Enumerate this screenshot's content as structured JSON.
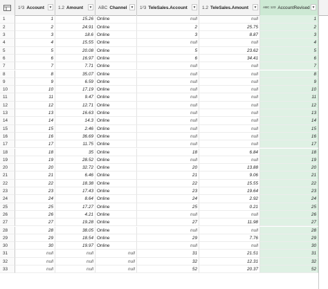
{
  "columns": [
    {
      "type_label": "1²3",
      "title": "Account"
    },
    {
      "type_label": "1.2",
      "title": "Amount"
    },
    {
      "type_label": "ABC",
      "title": "Channel"
    },
    {
      "type_label": "1²3",
      "title": "TeleSales.Account"
    },
    {
      "type_label": "1.2",
      "title": "TeleSales.Amount"
    },
    {
      "type_label": "ABC 123",
      "title": "AccountRevised"
    }
  ],
  "rows": [
    {
      "n": "1",
      "account": "1",
      "amount": "15.26",
      "channel": "Online",
      "ts_account": "null",
      "ts_amount": "null",
      "revised": "1"
    },
    {
      "n": "2",
      "account": "2",
      "amount": "24.91",
      "channel": "Online",
      "ts_account": "2",
      "ts_amount": "25.75",
      "revised": "2"
    },
    {
      "n": "3",
      "account": "3",
      "amount": "18.6",
      "channel": "Online",
      "ts_account": "3",
      "ts_amount": "8.87",
      "revised": "3"
    },
    {
      "n": "4",
      "account": "4",
      "amount": "15.55",
      "channel": "Online",
      "ts_account": "null",
      "ts_amount": "null",
      "revised": "4"
    },
    {
      "n": "5",
      "account": "5",
      "amount": "20.08",
      "channel": "Online",
      "ts_account": "5",
      "ts_amount": "23.62",
      "revised": "5"
    },
    {
      "n": "6",
      "account": "6",
      "amount": "16.97",
      "channel": "Online",
      "ts_account": "6",
      "ts_amount": "34.41",
      "revised": "6"
    },
    {
      "n": "7",
      "account": "7",
      "amount": "7.71",
      "channel": "Online",
      "ts_account": "null",
      "ts_amount": "null",
      "revised": "7"
    },
    {
      "n": "8",
      "account": "8",
      "amount": "35.07",
      "channel": "Online",
      "ts_account": "null",
      "ts_amount": "null",
      "revised": "8"
    },
    {
      "n": "9",
      "account": "9",
      "amount": "6.59",
      "channel": "Online",
      "ts_account": "null",
      "ts_amount": "null",
      "revised": "9"
    },
    {
      "n": "10",
      "account": "10",
      "amount": "17.19",
      "channel": "Online",
      "ts_account": "null",
      "ts_amount": "null",
      "revised": "10"
    },
    {
      "n": "11",
      "account": "11",
      "amount": "9.47",
      "channel": "Online",
      "ts_account": "null",
      "ts_amount": "null",
      "revised": "11"
    },
    {
      "n": "12",
      "account": "12",
      "amount": "12.71",
      "channel": "Online",
      "ts_account": "null",
      "ts_amount": "null",
      "revised": "12"
    },
    {
      "n": "13",
      "account": "13",
      "amount": "16.63",
      "channel": "Online",
      "ts_account": "null",
      "ts_amount": "null",
      "revised": "13"
    },
    {
      "n": "14",
      "account": "14",
      "amount": "14.3",
      "channel": "Online",
      "ts_account": "null",
      "ts_amount": "null",
      "revised": "14"
    },
    {
      "n": "15",
      "account": "15",
      "amount": "2.46",
      "channel": "Online",
      "ts_account": "null",
      "ts_amount": "null",
      "revised": "15"
    },
    {
      "n": "16",
      "account": "16",
      "amount": "36.69",
      "channel": "Online",
      "ts_account": "null",
      "ts_amount": "null",
      "revised": "16"
    },
    {
      "n": "17",
      "account": "17",
      "amount": "11.75",
      "channel": "Online",
      "ts_account": "null",
      "ts_amount": "null",
      "revised": "17"
    },
    {
      "n": "18",
      "account": "18",
      "amount": "35",
      "channel": "Online",
      "ts_account": "18",
      "ts_amount": "6.84",
      "revised": "18"
    },
    {
      "n": "19",
      "account": "19",
      "amount": "28.52",
      "channel": "Online",
      "ts_account": "null",
      "ts_amount": "null",
      "revised": "19"
    },
    {
      "n": "20",
      "account": "20",
      "amount": "32.72",
      "channel": "Online",
      "ts_account": "20",
      "ts_amount": "13.88",
      "revised": "20"
    },
    {
      "n": "21",
      "account": "21",
      "amount": "6.46",
      "channel": "Online",
      "ts_account": "21",
      "ts_amount": "9.06",
      "revised": "21"
    },
    {
      "n": "22",
      "account": "22",
      "amount": "18.38",
      "channel": "Online",
      "ts_account": "22",
      "ts_amount": "15.55",
      "revised": "22"
    },
    {
      "n": "23",
      "account": "23",
      "amount": "17.43",
      "channel": "Online",
      "ts_account": "23",
      "ts_amount": "19.64",
      "revised": "23"
    },
    {
      "n": "24",
      "account": "24",
      "amount": "8.64",
      "channel": "Online",
      "ts_account": "24",
      "ts_amount": "2.92",
      "revised": "24"
    },
    {
      "n": "25",
      "account": "25",
      "amount": "17.27",
      "channel": "Online",
      "ts_account": "25",
      "ts_amount": "0.21",
      "revised": "25"
    },
    {
      "n": "26",
      "account": "26",
      "amount": "4.21",
      "channel": "Online",
      "ts_account": "null",
      "ts_amount": "null",
      "revised": "26"
    },
    {
      "n": "27",
      "account": "27",
      "amount": "19.28",
      "channel": "Online",
      "ts_account": "27",
      "ts_amount": "11.98",
      "revised": "27"
    },
    {
      "n": "28",
      "account": "28",
      "amount": "38.05",
      "channel": "Online",
      "ts_account": "null",
      "ts_amount": "null",
      "revised": "28"
    },
    {
      "n": "29",
      "account": "29",
      "amount": "18.54",
      "channel": "Online",
      "ts_account": "29",
      "ts_amount": "7.76",
      "revised": "29"
    },
    {
      "n": "30",
      "account": "30",
      "amount": "19.97",
      "channel": "Online",
      "ts_account": "null",
      "ts_amount": "null",
      "revised": "30"
    },
    {
      "n": "31",
      "account": "null",
      "amount": "null",
      "channel": "null",
      "ts_account": "31",
      "ts_amount": "21.51",
      "revised": "31"
    },
    {
      "n": "32",
      "account": "null",
      "amount": "null",
      "channel": "null",
      "ts_account": "32",
      "ts_amount": "12.31",
      "revised": "32"
    },
    {
      "n": "33",
      "account": "null",
      "amount": "null",
      "channel": "null",
      "ts_account": "52",
      "ts_amount": "20.37",
      "revised": "52"
    }
  ],
  "colors": {
    "selected_column": "#dff1e4",
    "header_selected": "#cde9d4"
  }
}
